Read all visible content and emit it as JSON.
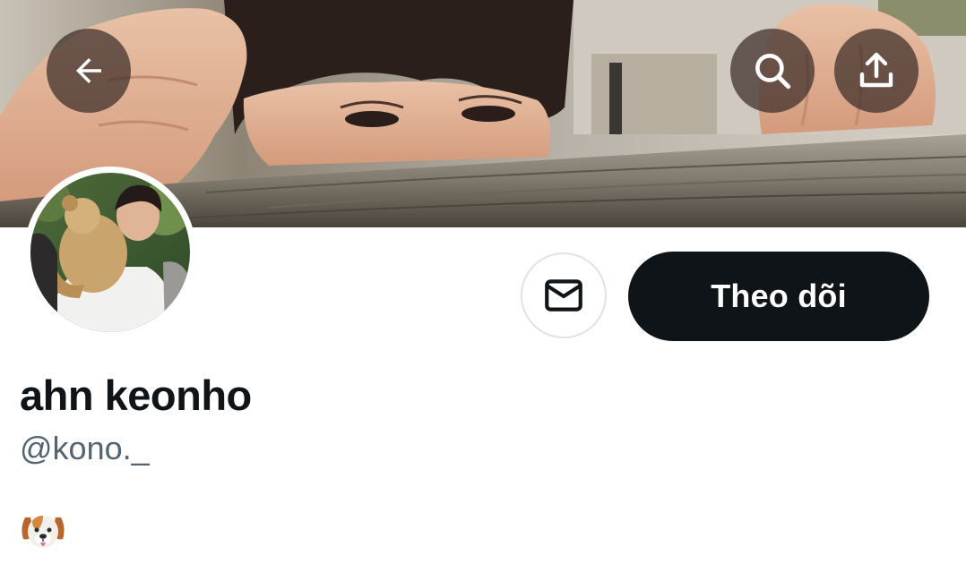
{
  "header": {
    "back_icon": "arrow-left-icon",
    "search_icon": "search-icon",
    "share_icon": "share-upload-icon"
  },
  "profile": {
    "display_name": "ahn keonho",
    "handle": "@kono._",
    "bio_emoji": "dog-face-emoji"
  },
  "actions": {
    "message_icon": "envelope-icon",
    "follow_label": "Theo dõi"
  },
  "colors": {
    "follow_bg": "#0f1419",
    "follow_text": "#ffffff",
    "name_text": "#0f1419",
    "handle_text": "#536471",
    "border": "#dfe3e6",
    "overlay_button": "#3c2d28"
  }
}
